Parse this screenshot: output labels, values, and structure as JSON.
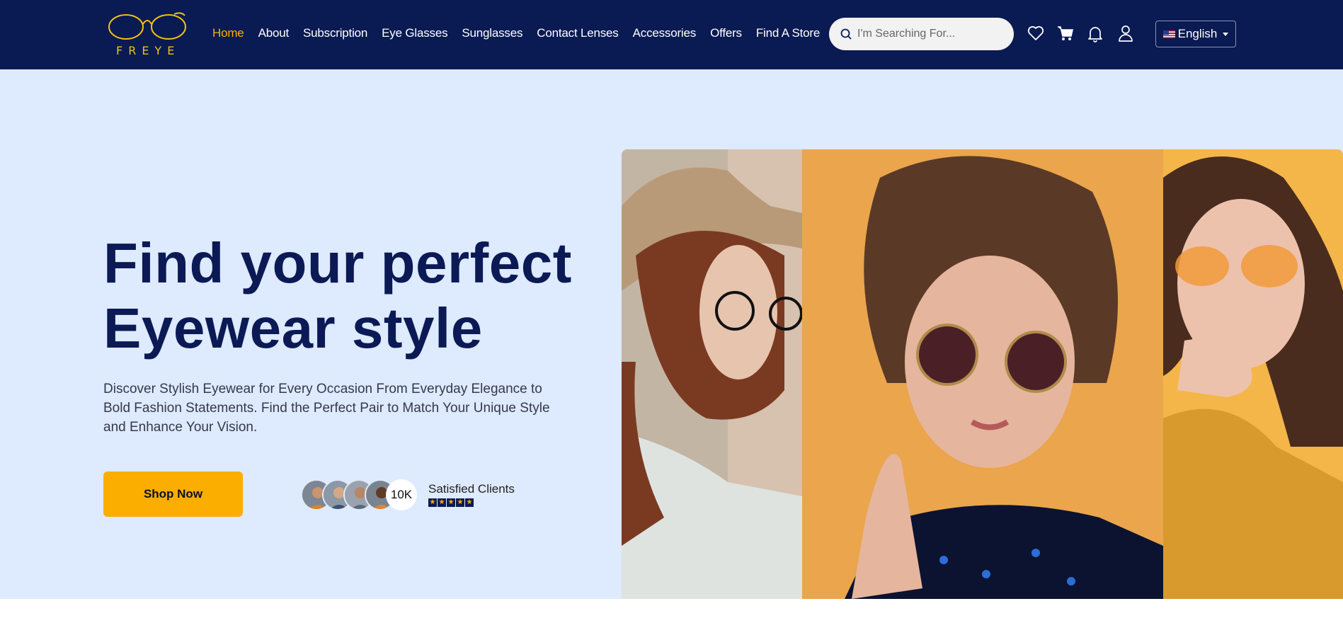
{
  "header": {
    "logo_text": "FREYE",
    "nav": [
      {
        "label": "Home",
        "active": true
      },
      {
        "label": "About"
      },
      {
        "label": "Subscription"
      },
      {
        "label": "Eye Glasses"
      },
      {
        "label": "Sunglasses"
      },
      {
        "label": "Contact Lenses"
      },
      {
        "label": "Accessories"
      },
      {
        "label": "Offers"
      },
      {
        "label": "Find A Store"
      }
    ],
    "search_placeholder": "I'm Searching For...",
    "icons": [
      "heart-icon",
      "cart-icon",
      "bell-icon",
      "user-icon"
    ],
    "language": "English"
  },
  "hero": {
    "headline_line1": "Find your perfect",
    "headline_line2": "Eyewear style",
    "description": "Discover Stylish Eyewear for Every Occasion From Everyday Elegance to Bold Fashion Statements. Find the Perfect Pair to Match Your Unique Style and Enhance Your Vision.",
    "cta_label": "Shop Now",
    "clients_count": "10K",
    "clients_label": "Satisfied Clients",
    "rating_stars": 5
  },
  "colors": {
    "header_bg": "#0a1a52",
    "hero_bg": "#deeafd",
    "accent": "#fbad00",
    "active_nav": "#f6b100",
    "headline": "#0b1a55"
  }
}
